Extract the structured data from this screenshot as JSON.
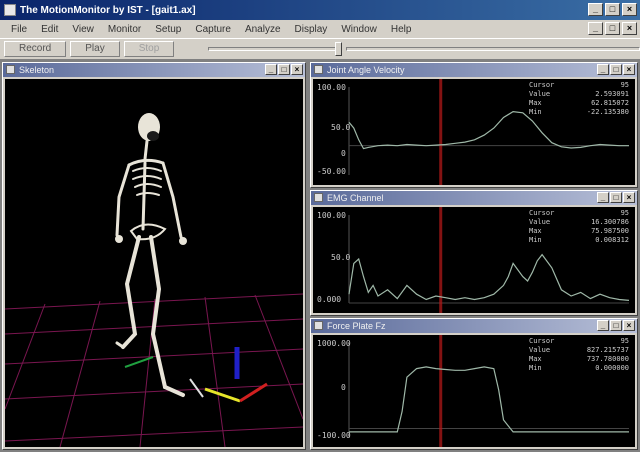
{
  "window": {
    "title": "The MotionMonitor by IST - [gait1.ax]",
    "buttons": [
      "_",
      "□",
      "×"
    ]
  },
  "menu": {
    "items": [
      "File",
      "Edit",
      "View",
      "Monitor",
      "Setup",
      "Capture",
      "Analyze",
      "Display",
      "Window",
      "Help"
    ],
    "child_buttons": [
      "_",
      "□",
      "×"
    ]
  },
  "toolbar": {
    "record_label": "Record",
    "play_label": "Play",
    "stop_label": "Stop"
  },
  "panes": {
    "skeleton_title": "Skeleton",
    "chart1_title": "Joint Angle Velocity",
    "chart2_title": "EMG Channel",
    "chart3_title": "Force Plate Fz",
    "child_buttons": [
      "_",
      "□",
      "×"
    ]
  },
  "colors": {
    "trace": "#9fb8a8",
    "cursor": "#b01818",
    "grid": "#8a1a5a"
  },
  "chart_data": [
    {
      "type": "line",
      "title": "Joint Angle Velocity",
      "ylim": [
        -50,
        100
      ],
      "yticks": [
        "100.00",
        "50.0",
        "0",
        "-50.00"
      ],
      "stats": [
        [
          "Cursor",
          "95"
        ],
        [
          "Value",
          "2.593091"
        ],
        [
          "Max",
          "62.815072"
        ],
        [
          "Min",
          "-22.135380"
        ]
      ],
      "x": [
        0,
        5,
        10,
        15,
        20,
        30,
        40,
        50,
        60,
        70,
        80,
        90,
        100,
        110,
        120,
        130,
        140,
        150,
        160,
        170,
        180,
        190,
        200,
        210,
        220,
        230,
        240,
        250,
        260,
        270,
        280,
        290
      ],
      "y": [
        40,
        30,
        10,
        -5,
        -3,
        0,
        1,
        0,
        2,
        1,
        0,
        1,
        2,
        4,
        6,
        10,
        18,
        30,
        48,
        58,
        56,
        42,
        22,
        5,
        -2,
        -4,
        -3,
        0,
        2,
        1,
        0,
        0
      ],
      "cursor_x": 95
    },
    {
      "type": "line",
      "title": "EMG Channel",
      "ylim": [
        0,
        100
      ],
      "yticks": [
        "100.00",
        "50.0",
        "0.000"
      ],
      "stats": [
        [
          "Cursor",
          "95"
        ],
        [
          "Value",
          "16.300786"
        ],
        [
          "Max",
          "75.987500"
        ],
        [
          "Min",
          "0.008312"
        ]
      ],
      "x": [
        0,
        5,
        10,
        15,
        20,
        25,
        30,
        40,
        50,
        60,
        70,
        80,
        90,
        100,
        110,
        120,
        130,
        140,
        150,
        160,
        165,
        170,
        180,
        185,
        190,
        195,
        200,
        210,
        220,
        230,
        240,
        250,
        260,
        270,
        280,
        290
      ],
      "y": [
        10,
        45,
        50,
        30,
        12,
        20,
        8,
        15,
        5,
        20,
        10,
        4,
        8,
        6,
        4,
        6,
        4,
        6,
        10,
        20,
        30,
        45,
        30,
        25,
        35,
        48,
        55,
        40,
        15,
        8,
        12,
        5,
        10,
        6,
        4,
        3
      ],
      "cursor_x": 95
    },
    {
      "type": "line",
      "title": "Force Plate Fz",
      "ylim": [
        -100,
        1000
      ],
      "yticks": [
        "1000.00",
        "0",
        "-100.00"
      ],
      "stats": [
        [
          "Cursor",
          "95"
        ],
        [
          "Value",
          "827.215737"
        ],
        [
          "Max",
          "737.780000"
        ],
        [
          "Min",
          "0.000000"
        ]
      ],
      "x": [
        0,
        40,
        50,
        55,
        60,
        70,
        80,
        90,
        100,
        110,
        120,
        130,
        140,
        150,
        155,
        160,
        170,
        180,
        190,
        200,
        240,
        290
      ],
      "y": [
        -40,
        -40,
        -40,
        200,
        600,
        700,
        720,
        700,
        690,
        680,
        680,
        700,
        720,
        700,
        450,
        100,
        -40,
        -40,
        -40,
        -40,
        -40,
        -40
      ],
      "cursor_x": 95
    }
  ]
}
